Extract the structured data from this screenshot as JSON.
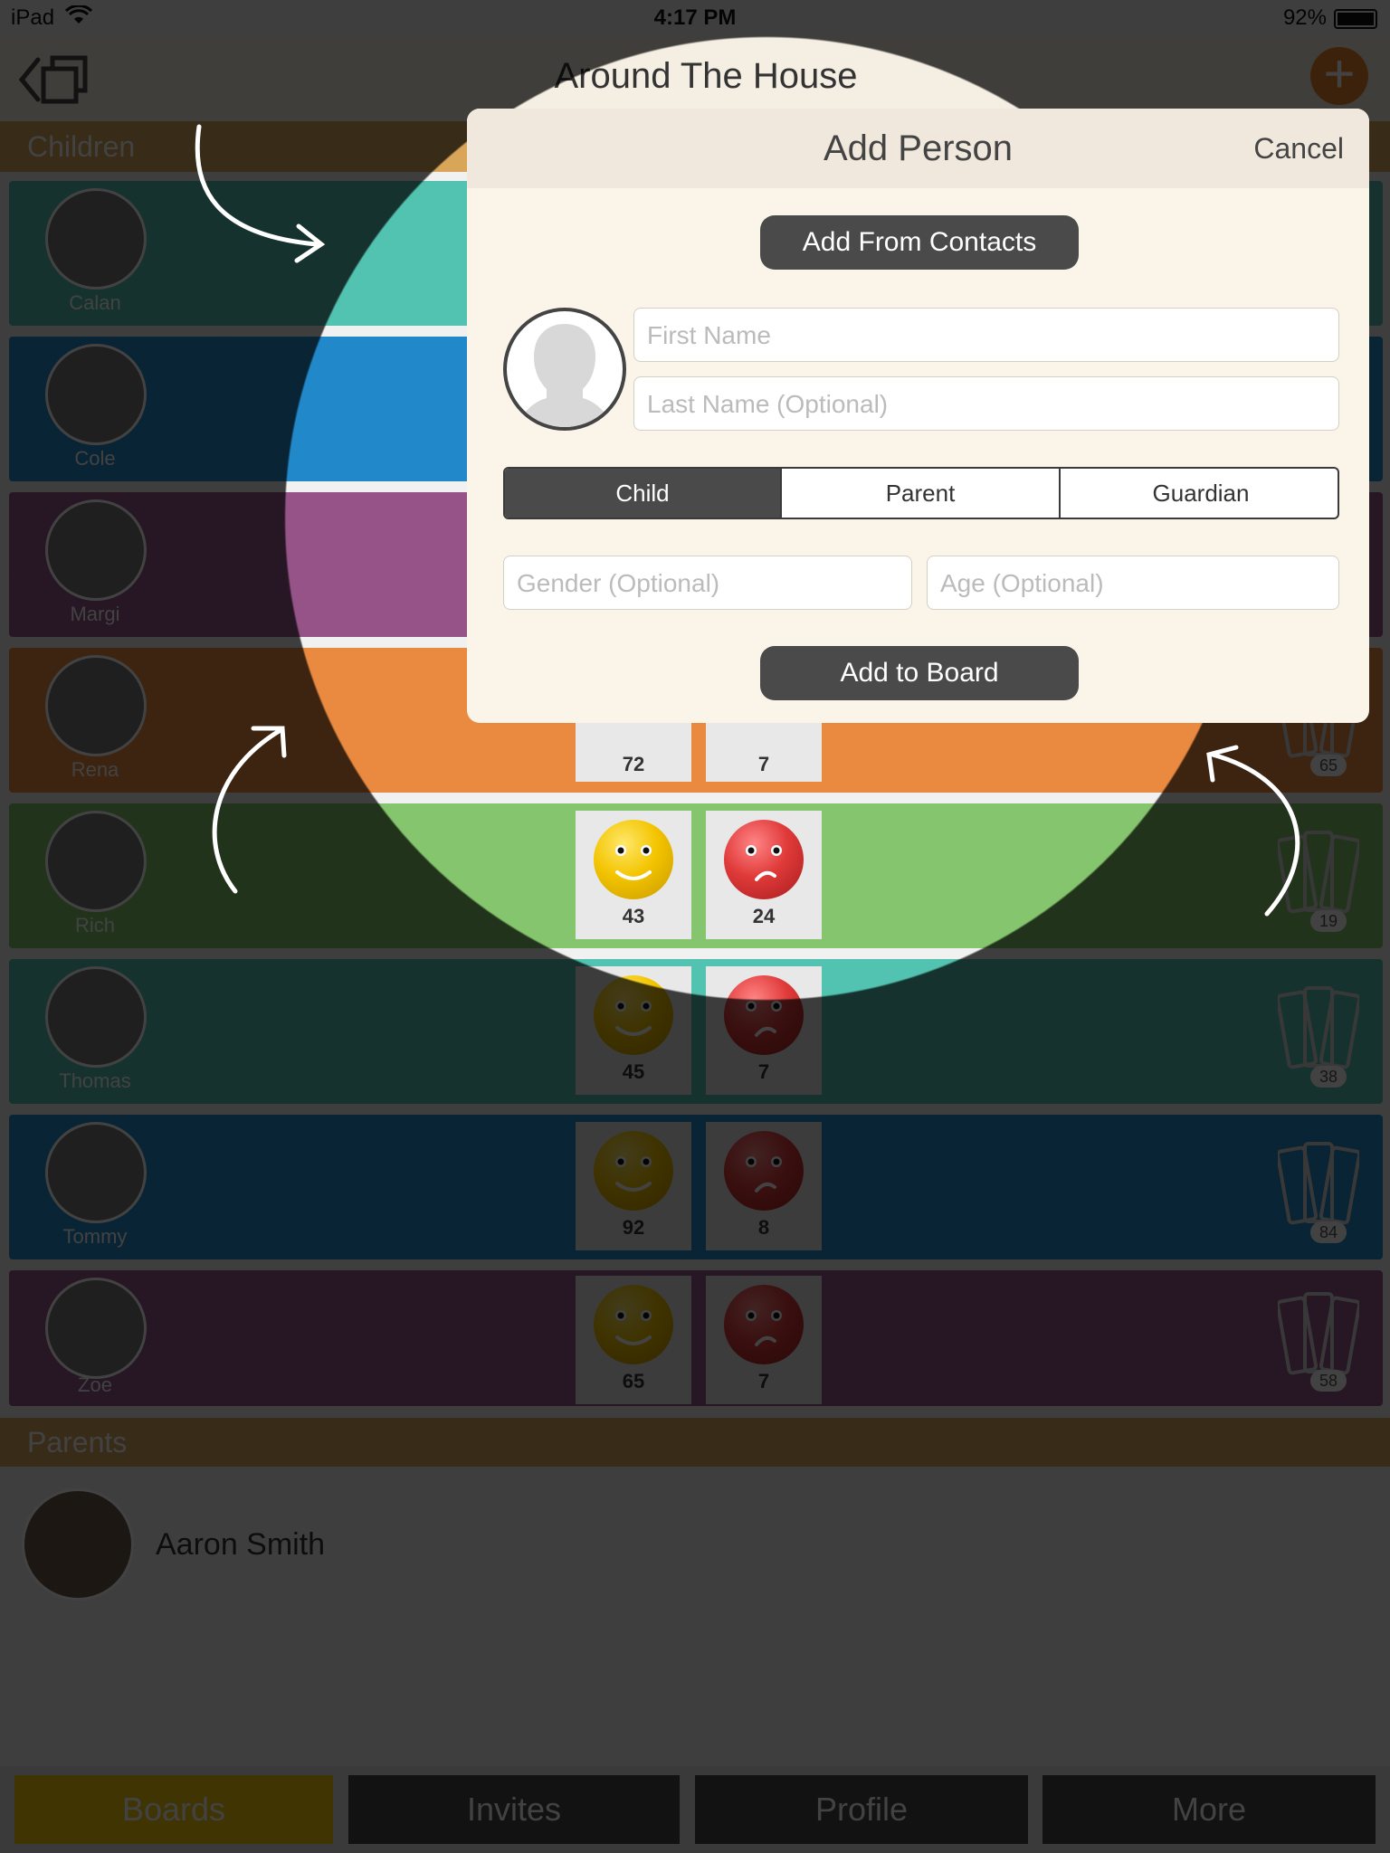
{
  "status_bar": {
    "carrier": "iPad",
    "time": "4:17 PM",
    "battery": "92%"
  },
  "nav": {
    "title": "Around The House"
  },
  "sections": {
    "children": "Children",
    "parents": "Parents"
  },
  "children": [
    {
      "name": "Calan",
      "color": "#52c3b1",
      "good": "",
      "bad": "",
      "cards": ""
    },
    {
      "name": "Cole",
      "color": "#2189ca",
      "good": "",
      "bad": "",
      "cards": ""
    },
    {
      "name": "Margi",
      "color": "#955388",
      "good": "",
      "bad": "",
      "cards": ""
    },
    {
      "name": "Rena",
      "color": "#e98a40",
      "good": "72",
      "bad": "7",
      "cards": "65"
    },
    {
      "name": "Rich",
      "color": "#84c56d",
      "good": "43",
      "bad": "24",
      "cards": "19"
    },
    {
      "name": "Thomas",
      "color": "#52c3b1",
      "good": "45",
      "bad": "7",
      "cards": "38"
    },
    {
      "name": "Tommy",
      "color": "#2189ca",
      "good": "92",
      "bad": "8",
      "cards": "84"
    },
    {
      "name": "Zoe",
      "color": "#955388",
      "good": "65",
      "bad": "7",
      "cards": "58"
    }
  ],
  "parents": [
    {
      "name": "Aaron Smith"
    }
  ],
  "tabs": [
    {
      "label": "Boards",
      "active": true
    },
    {
      "label": "Invites",
      "active": false
    },
    {
      "label": "Profile",
      "active": false
    },
    {
      "label": "More",
      "active": false
    }
  ],
  "modal": {
    "title": "Add Person",
    "cancel": "Cancel",
    "add_from_contacts": "Add From Contacts",
    "first_name_placeholder": "First Name",
    "last_name_placeholder": "Last Name (Optional)",
    "role_options": [
      "Child",
      "Parent",
      "Guardian"
    ],
    "selected_role": "Child",
    "gender_placeholder": "Gender (Optional)",
    "age_placeholder": "Age  (Optional)",
    "add_to_board": "Add to Board"
  },
  "colors": {
    "accent": "#e8842a",
    "tab_active": "#f5c70a",
    "section_header": "#d9a659",
    "modal_bg": "#fbf4e9"
  }
}
